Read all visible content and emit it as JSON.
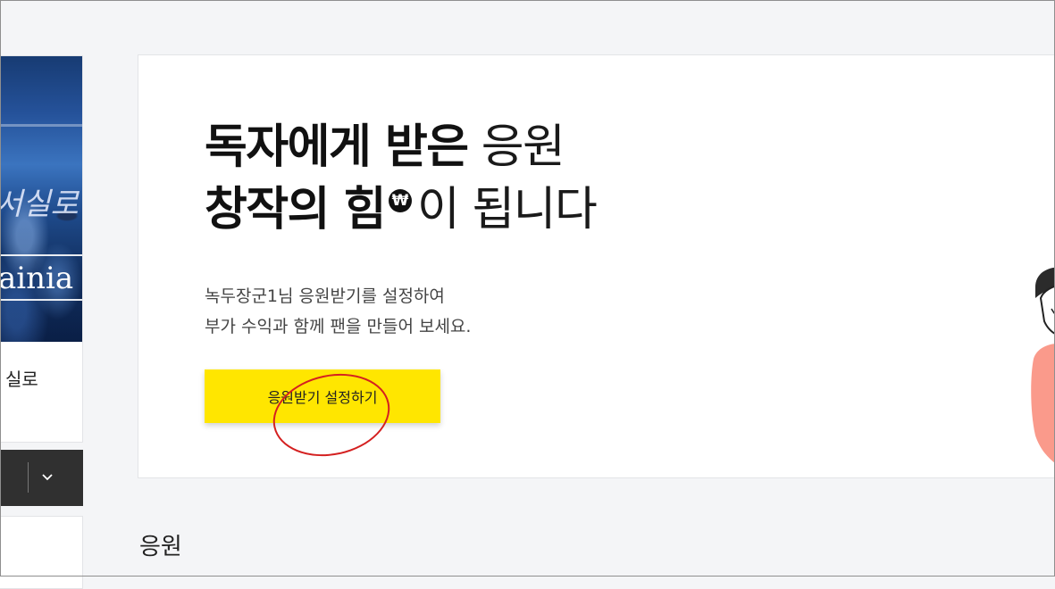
{
  "sidebar": {
    "cover": {
      "script_text": "서실로",
      "brand_text": "ainia"
    },
    "item_label": "실로"
  },
  "hero": {
    "headline_line1_bold": "독자에게 받은",
    "headline_line1_light": "응원",
    "headline_line2_bold": "창작의 힘",
    "won_symbol": "₩",
    "headline_line2_light": "이 됩니다",
    "description_line1": "녹두장군1님 응원받기를 설정하여",
    "description_line2": "부가 수익과 함께 팬을 만들어 보세요.",
    "cta_label": "응원받기 설정하기"
  },
  "section": {
    "title": "응원"
  },
  "colors": {
    "cta_background": "#ffe600",
    "annotation_circle": "#d42020",
    "illustration_shirt": "#fa9a8b"
  }
}
